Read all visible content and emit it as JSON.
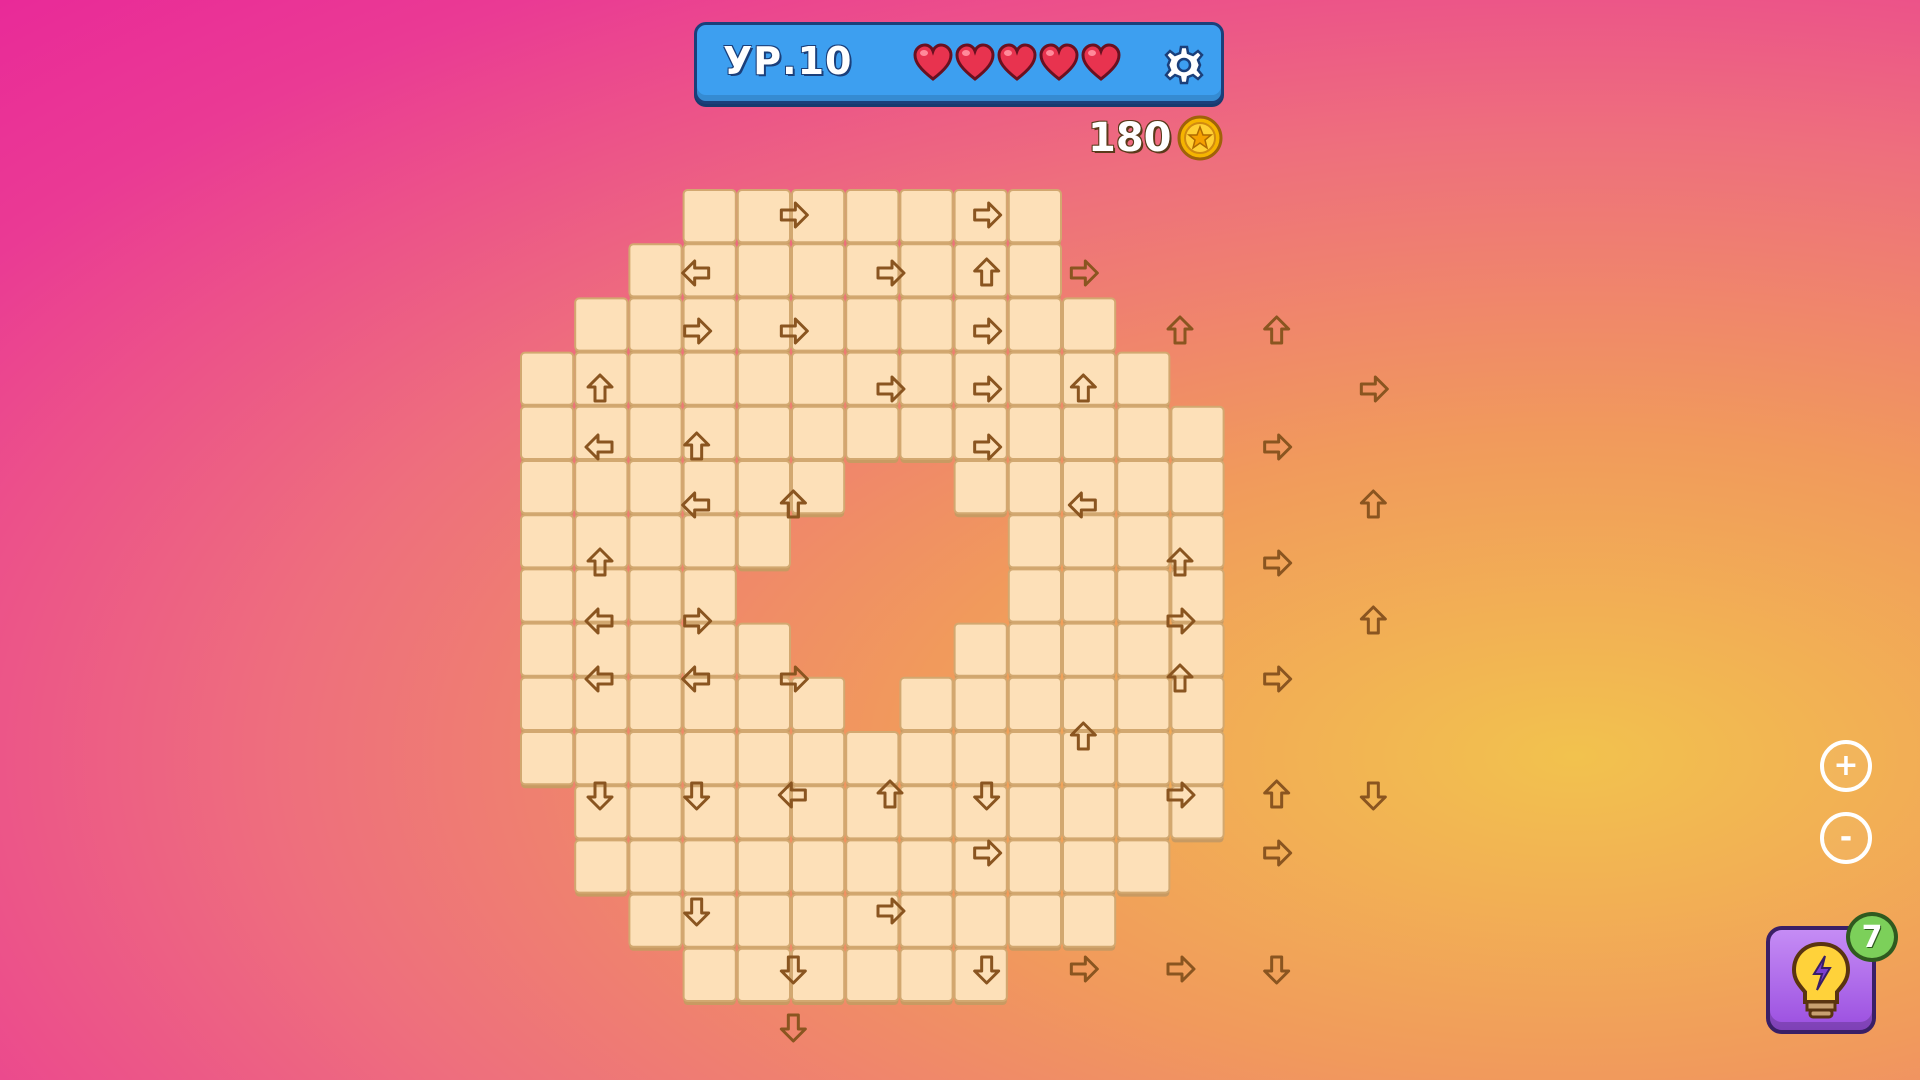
{
  "hud": {
    "level_label": "УР.10",
    "lives": 5,
    "heart_icon": "heart-icon",
    "settings_icon": "gear-icon"
  },
  "coins": {
    "amount": "180",
    "icon": "star-coin-icon"
  },
  "controls": {
    "zoom_in_label": "+",
    "zoom_out_label": "-",
    "hint_icon": "lightbulb-icon",
    "hint_count": "7"
  },
  "board": {
    "tile_color": "#fde0b8",
    "arrow_color": "#8a5520",
    "arrows": [
      {
        "col": 2,
        "row": 0,
        "dir": "right"
      },
      {
        "col": 4,
        "row": 0,
        "dir": "right"
      },
      {
        "col": 1,
        "row": 1,
        "dir": "left"
      },
      {
        "col": 3,
        "row": 1,
        "dir": "right"
      },
      {
        "col": 4,
        "row": 1,
        "dir": "up"
      },
      {
        "col": 5,
        "row": 1,
        "dir": "right"
      },
      {
        "col": 1,
        "row": 2,
        "dir": "right"
      },
      {
        "col": 2,
        "row": 2,
        "dir": "right"
      },
      {
        "col": 4,
        "row": 2,
        "dir": "right"
      },
      {
        "col": 6,
        "row": 2,
        "dir": "up"
      },
      {
        "col": 7,
        "row": 2,
        "dir": "up"
      },
      {
        "col": 0,
        "row": 3,
        "dir": "up"
      },
      {
        "col": 3,
        "row": 3,
        "dir": "right"
      },
      {
        "col": 4,
        "row": 3,
        "dir": "right"
      },
      {
        "col": 5,
        "row": 3,
        "dir": "up"
      },
      {
        "col": 8,
        "row": 3,
        "dir": "right"
      },
      {
        "col": 0,
        "row": 4,
        "dir": "left"
      },
      {
        "col": 1,
        "row": 4,
        "dir": "up"
      },
      {
        "col": 4,
        "row": 4,
        "dir": "right"
      },
      {
        "col": 7,
        "row": 4,
        "dir": "right"
      },
      {
        "col": 2,
        "row": 5,
        "dir": "up"
      },
      {
        "col": 1,
        "row": 5,
        "dir": "left"
      },
      {
        "col": 2,
        "row": 5,
        "dir": "up"
      },
      {
        "col": 5,
        "row": 5,
        "dir": "left"
      },
      {
        "col": 8,
        "row": 5,
        "dir": "up"
      },
      {
        "col": 0,
        "row": 6,
        "dir": "up"
      },
      {
        "col": 6,
        "row": 6,
        "dir": "up"
      },
      {
        "col": 7,
        "row": 6,
        "dir": "right"
      },
      {
        "col": 0,
        "row": 7,
        "dir": "left"
      },
      {
        "col": 1,
        "row": 7,
        "dir": "right"
      },
      {
        "col": 6,
        "row": 7,
        "dir": "right"
      },
      {
        "col": 8,
        "row": 7,
        "dir": "up"
      },
      {
        "col": 0,
        "row": 8,
        "dir": "left"
      },
      {
        "col": 1,
        "row": 8,
        "dir": "left"
      },
      {
        "col": 2,
        "row": 8,
        "dir": "right"
      },
      {
        "col": 6,
        "row": 8,
        "dir": "up"
      },
      {
        "col": 7,
        "row": 8,
        "dir": "right"
      },
      {
        "col": 5,
        "row": 9,
        "dir": "up"
      },
      {
        "col": 0,
        "row": 10,
        "dir": "down"
      },
      {
        "col": 1,
        "row": 10,
        "dir": "down"
      },
      {
        "col": 2,
        "row": 10,
        "dir": "left"
      },
      {
        "col": 3,
        "row": 10,
        "dir": "up"
      },
      {
        "col": 4,
        "row": 10,
        "dir": "down"
      },
      {
        "col": 6,
        "row": 10,
        "dir": "right"
      },
      {
        "col": 7,
        "row": 10,
        "dir": "up"
      },
      {
        "col": 8,
        "row": 10,
        "dir": "down"
      },
      {
        "col": 4,
        "row": 11,
        "dir": "right"
      },
      {
        "col": 7,
        "row": 11,
        "dir": "right"
      },
      {
        "col": 1,
        "row": 12,
        "dir": "down"
      },
      {
        "col": 3,
        "row": 12,
        "dir": "right"
      },
      {
        "col": 2,
        "row": 13,
        "dir": "down"
      },
      {
        "col": 4,
        "row": 13,
        "dir": "down"
      },
      {
        "col": 5,
        "row": 13,
        "dir": "right"
      },
      {
        "col": 6,
        "row": 13,
        "dir": "right"
      },
      {
        "col": 7,
        "row": 13,
        "dir": "down"
      },
      {
        "col": 2,
        "row": 14,
        "dir": "down"
      }
    ]
  }
}
